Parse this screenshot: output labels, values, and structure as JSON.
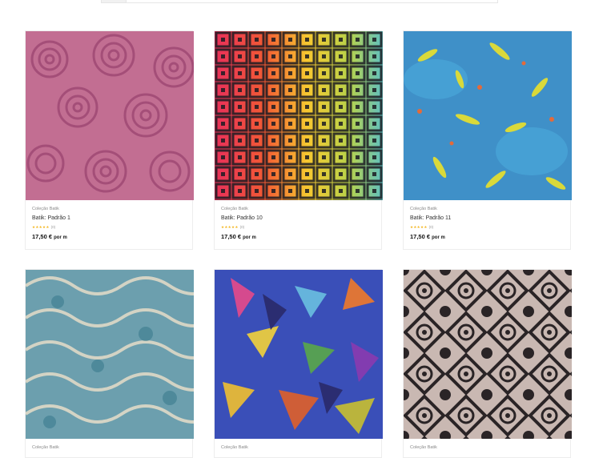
{
  "products": [
    {
      "collection": "Coleção Batik",
      "name": "Batik: Padrão 1",
      "stars": "★★★★★",
      "reviews": "(0)",
      "price": "17,50 €",
      "unit": "por m"
    },
    {
      "collection": "Coleção Batik",
      "name": "Batik: Padrão 10",
      "stars": "★★★★★",
      "reviews": "(0)",
      "price": "17,50 €",
      "unit": "por m"
    },
    {
      "collection": "Coleção Batik",
      "name": "Batik: Padrão 11",
      "stars": "★★★★★",
      "reviews": "(0)",
      "price": "17,50 €",
      "unit": "por m"
    },
    {
      "collection": "Coleção Batik"
    },
    {
      "collection": "Coleção Batik"
    },
    {
      "collection": "Coleção Batik"
    }
  ],
  "colors": {
    "star": "#f3b61f",
    "price": "#111111"
  }
}
